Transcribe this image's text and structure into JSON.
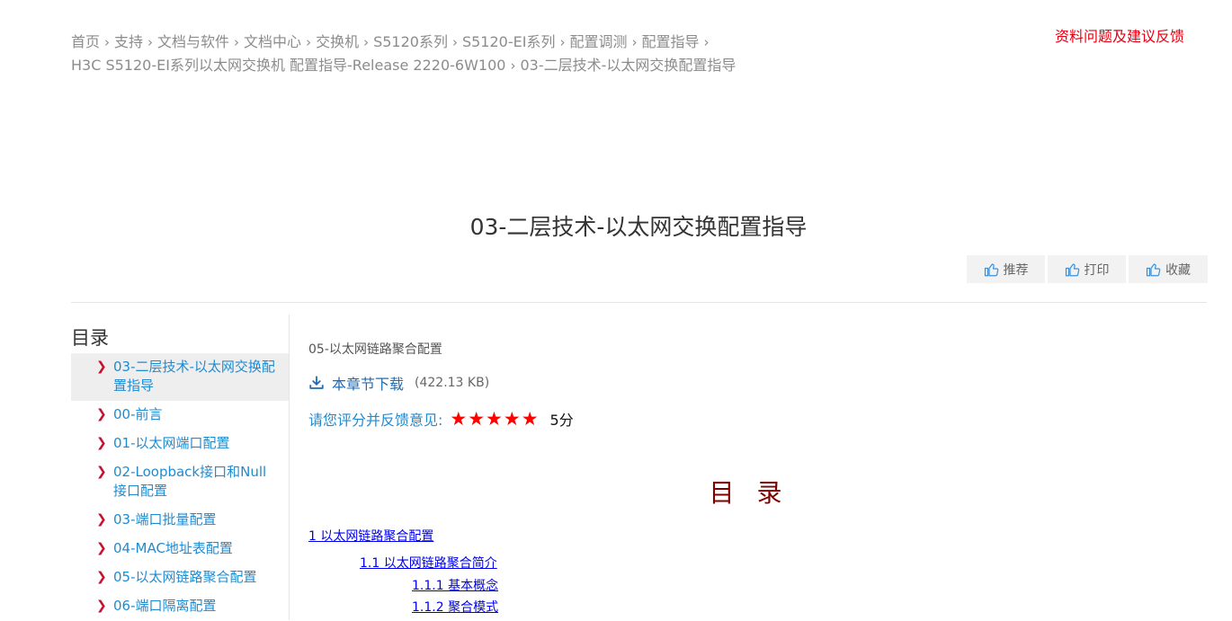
{
  "breadcrumb": {
    "items": [
      "首页",
      "支持",
      "文档与软件",
      "文档中心",
      "交换机",
      "S5120系列",
      "S5120-EI系列",
      "配置调测",
      "配置指导",
      "H3C S5120-EI系列以太网交换机 配置指导-Release 2220-6W100",
      "03-二层技术-以太网交换配置指导"
    ],
    "separator": "›"
  },
  "feedback_link": "资料问题及建议反馈",
  "page_title": "03-二层技术-以太网交换配置指导",
  "actions": {
    "recommend": "推荐",
    "print": "打印",
    "favorite": "收藏"
  },
  "sidebar": {
    "heading": "目录",
    "items": [
      {
        "label": "03-二层技术-以太网交换配置指导",
        "active": true
      },
      {
        "label": "00-前言"
      },
      {
        "label": "01-以太网端口配置"
      },
      {
        "label": "02-Loopback接口和Null接口配置"
      },
      {
        "label": "03-端口批量配置"
      },
      {
        "label": "04-MAC地址表配置"
      },
      {
        "label": "05-以太网链路聚合配置"
      },
      {
        "label": "06-端口隔离配置"
      }
    ]
  },
  "content": {
    "section_name": "05-以太网链路聚合配置",
    "download_label": "本章节下载",
    "file_size": "(422.13 KB)",
    "rating_prompt": "请您评分并反馈意见:",
    "stars": "★★★★★",
    "score": "5分",
    "doc_heading": "目 录",
    "toc_links": [
      "1 以太网链路聚合配置",
      "1.1 以太网链路聚合简介",
      "1.1.1 基本概念",
      "1.1.2 聚合模式"
    ]
  },
  "colors": {
    "accent_red": "#e60012",
    "link_blue": "#1f8bd1",
    "star_red": "#ff0000",
    "doc_heading": "#800000"
  }
}
